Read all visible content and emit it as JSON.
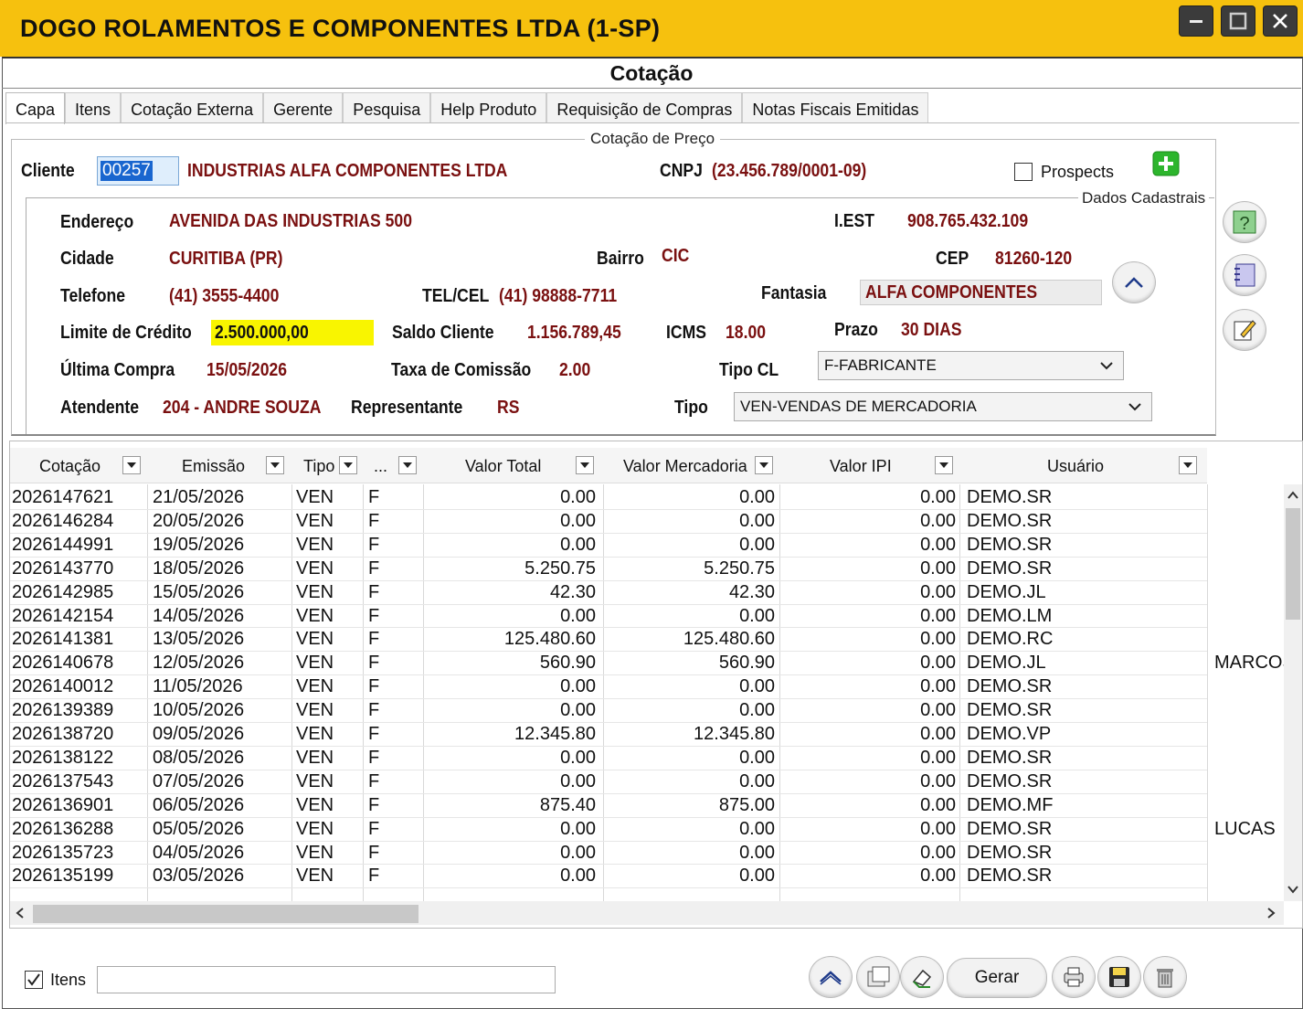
{
  "window": {
    "title": "DOGO ROLAMENTOS E COMPONENTES LTDA (1-SP)",
    "form_title": "Cotação"
  },
  "tabs": [
    "Capa",
    "Itens",
    "Cotação Externa",
    "Gerente",
    "Pesquisa",
    "Help Produto",
    "Requisição de Compras",
    "Notas Fiscais Emitidas"
  ],
  "header": {
    "group_title": "Cotação de Preço",
    "cliente_label": "Cliente",
    "cliente_code": "00257",
    "cliente_name": "INDUSTRIAS ALFA COMPONENTES LTDA",
    "cnpj_label": "CNPJ",
    "cnpj_value": "(23.456.789/0001-09)",
    "prospects_label": "Prospects",
    "dados_title": "Dados Cadastrais"
  },
  "dados": {
    "endereco_label": "Endereço",
    "endereco": "AVENIDA DAS INDUSTRIAS 500",
    "iest_label": "I.EST",
    "iest": "908.765.432.109",
    "cidade_label": "Cidade",
    "cidade": "CURITIBA (PR)",
    "bairro_label": "Bairro",
    "bairro": "CIC",
    "cep_label": "CEP",
    "cep": "81260-120",
    "telefone_label": "Telefone",
    "telefone": "(41) 3555-4400",
    "telcel_label": "TEL/CEL",
    "telcel": "(41) 98888-7711",
    "fantasia_label": "Fantasia",
    "fantasia": "ALFA COMPONENTES",
    "limite_label": "Limite de Crédito",
    "limite": "2.500.000,00",
    "saldo_label": "Saldo Cliente",
    "saldo": "1.156.789,45",
    "icms_label": "ICMS",
    "icms": "18.00",
    "prazo_label": "Prazo",
    "prazo": "30 DIAS",
    "ultima_label": "Última Compra",
    "ultima": "15/05/2026",
    "taxa_label": "Taxa de Comissão",
    "taxa": "2.00",
    "tipocl_label": "Tipo CL",
    "tipocl": "F-FABRICANTE",
    "atendente_label": "Atendente",
    "atendente": "204 - ANDRE SOUZA",
    "representante_label": "Representante",
    "representante": "RS",
    "tipo_label": "Tipo",
    "tipo": "VEN-VENDAS DE MERCADORIA"
  },
  "grid": {
    "columns": [
      "Cotação",
      "Emissão",
      "Tipo",
      "...",
      "Valor Total",
      "Valor Mercadoria",
      "Valor IPI",
      "Usuário"
    ],
    "rows": [
      [
        "2026147621",
        "21/05/2026",
        "VEN",
        "F",
        "0.00",
        "0.00",
        "0.00",
        "DEMO.SR",
        ""
      ],
      [
        "2026146284",
        "20/05/2026",
        "VEN",
        "F",
        "0.00",
        "0.00",
        "0.00",
        "DEMO.SR",
        ""
      ],
      [
        "2026144991",
        "19/05/2026",
        "VEN",
        "F",
        "0.00",
        "0.00",
        "0.00",
        "DEMO.SR",
        ""
      ],
      [
        "2026143770",
        "18/05/2026",
        "VEN",
        "F",
        "5.250.75",
        "5.250.75",
        "0.00",
        "DEMO.SR",
        ""
      ],
      [
        "2026142985",
        "15/05/2026",
        "VEN",
        "F",
        "42.30",
        "42.30",
        "0.00",
        "DEMO.JL",
        ""
      ],
      [
        "2026142154",
        "14/05/2026",
        "VEN",
        "F",
        "0.00",
        "0.00",
        "0.00",
        "DEMO.LM",
        ""
      ],
      [
        "2026141381",
        "13/05/2026",
        "VEN",
        "F",
        "125.480.60",
        "125.480.60",
        "0.00",
        "DEMO.RC",
        ""
      ],
      [
        "2026140678",
        "12/05/2026",
        "VEN",
        "F",
        "560.90",
        "560.90",
        "0.00",
        "DEMO.JL",
        "MARCOS"
      ],
      [
        "2026140012",
        "11/05/2026",
        "VEN",
        "F",
        "0.00",
        "0.00",
        "0.00",
        "DEMO.SR",
        ""
      ],
      [
        "2026139389",
        "10/05/2026",
        "VEN",
        "F",
        "0.00",
        "0.00",
        "0.00",
        "DEMO.SR",
        ""
      ],
      [
        "2026138720",
        "09/05/2026",
        "VEN",
        "F",
        "12.345.80",
        "12.345.80",
        "0.00",
        "DEMO.VP",
        ""
      ],
      [
        "2026138122",
        "08/05/2026",
        "VEN",
        "F",
        "0.00",
        "0.00",
        "0.00",
        "DEMO.SR",
        ""
      ],
      [
        "2026137543",
        "07/05/2026",
        "VEN",
        "F",
        "0.00",
        "0.00",
        "0.00",
        "DEMO.SR",
        ""
      ],
      [
        "2026136901",
        "06/05/2026",
        "VEN",
        "F",
        "875.40",
        "875.00",
        "0.00",
        "DEMO.MF",
        ""
      ],
      [
        "2026136288",
        "05/05/2026",
        "VEN",
        "F",
        "0.00",
        "0.00",
        "0.00",
        "DEMO.SR",
        "LUCAS"
      ],
      [
        "2026135723",
        "04/05/2026",
        "VEN",
        "F",
        "0.00",
        "0.00",
        "0.00",
        "DEMO.SR",
        ""
      ],
      [
        "2026135199",
        "03/05/2026",
        "VEN",
        "F",
        "0.00",
        "0.00",
        "0.00",
        "DEMO.SR",
        ""
      ]
    ]
  },
  "footer": {
    "itens_label": "Itens",
    "itens_checked": true,
    "gerar_label": "Gerar"
  },
  "colors": {
    "titlebar": "#f6c10e",
    "value_text": "#7a1010",
    "credit_highlight": "#f9f500"
  }
}
